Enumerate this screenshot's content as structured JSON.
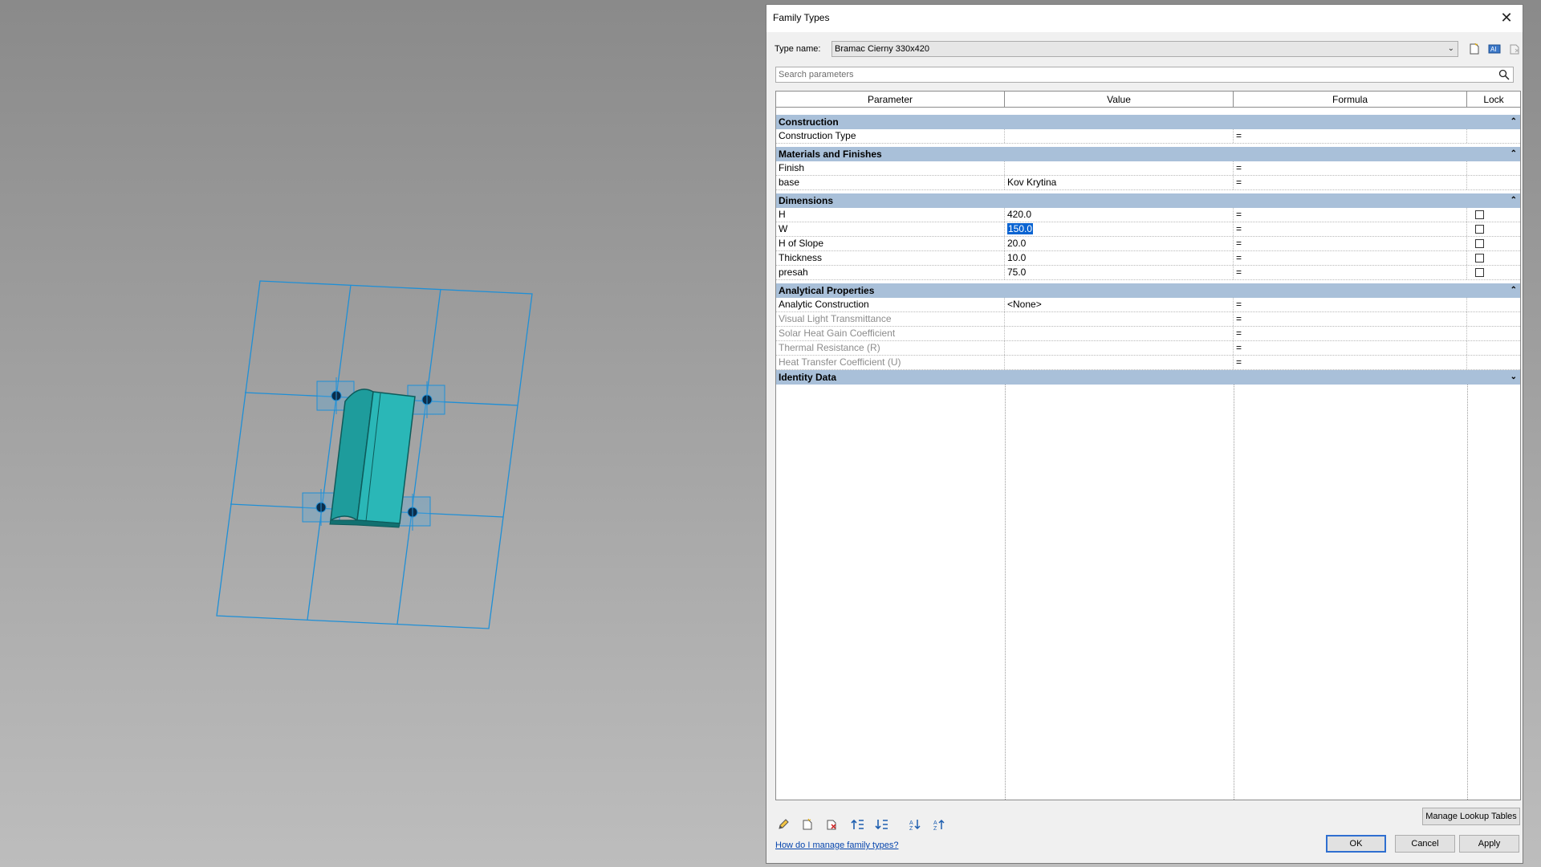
{
  "dialog": {
    "title": "Family Types",
    "close_glyph": "✕",
    "type_name_label": "Type name:",
    "type_name_value": "Bramac Cierny 330x420",
    "search_placeholder": "Search parameters",
    "toolbar_icons": [
      "new-type-icon",
      "rename-type-icon",
      "delete-type-icon"
    ],
    "columns": {
      "parameter": "Parameter",
      "value": "Value",
      "formula": "Formula",
      "lock": "Lock"
    },
    "groups": [
      {
        "label": "Construction",
        "toggle": "⌃",
        "rows": [
          {
            "param": "Construction Type",
            "value": "",
            "formula": "=",
            "lock": null
          }
        ]
      },
      {
        "label": "Materials and Finishes",
        "toggle": "⌃",
        "rows": [
          {
            "param": "Finish",
            "value": "",
            "formula": "=",
            "lock": null
          },
          {
            "param": "base",
            "value": "Kov Krytina",
            "formula": "=",
            "lock": null
          }
        ]
      },
      {
        "label": "Dimensions",
        "toggle": "⌃",
        "rows": [
          {
            "param": "H",
            "value": "420.0",
            "formula": "=",
            "lock": false
          },
          {
            "param": "W",
            "value": "150.0",
            "formula": "=",
            "lock": false,
            "selected": true
          },
          {
            "param": "H of Slope",
            "value": "20.0",
            "formula": "=",
            "lock": false
          },
          {
            "param": "Thickness",
            "value": "10.0",
            "formula": "=",
            "lock": false
          },
          {
            "param": "presah",
            "value": "75.0",
            "formula": "=",
            "lock": false
          }
        ]
      },
      {
        "label": "Analytical Properties",
        "toggle": "⌃",
        "rows": [
          {
            "param": "Analytic Construction",
            "value": "<None>",
            "formula": "=",
            "lock": null
          },
          {
            "param": "Visual Light Transmittance",
            "value": "",
            "formula": "=",
            "lock": null,
            "dimmed": true
          },
          {
            "param": "Solar Heat Gain Coefficient",
            "value": "",
            "formula": "=",
            "lock": null,
            "dimmed": true
          },
          {
            "param": "Thermal Resistance (R)",
            "value": "",
            "formula": "=",
            "lock": null,
            "dimmed": true
          },
          {
            "param": "Heat Transfer Coefficient (U)",
            "value": "",
            "formula": "=",
            "lock": null,
            "dimmed": true
          }
        ]
      },
      {
        "label": "Identity Data",
        "toggle": "⌄",
        "rows": []
      }
    ],
    "bottom_icons": [
      "edit-parameter-icon",
      "new-parameter-icon",
      "delete-parameter-icon",
      "move-up-icon",
      "move-down-icon",
      "sort-ascending-icon",
      "sort-descending-icon"
    ],
    "manage_lookup_label": "Manage Lookup Tables",
    "help_link": "How do I manage family types?",
    "ok_label": "OK",
    "cancel_label": "Cancel",
    "apply_label": "Apply"
  },
  "colors": {
    "viewport_bg": "#9a9a9a",
    "tile": "#2ab7b7",
    "reference_lines": "#1f8fd6",
    "group_header": "#a9c0d9",
    "selection": "#0a64d2"
  }
}
